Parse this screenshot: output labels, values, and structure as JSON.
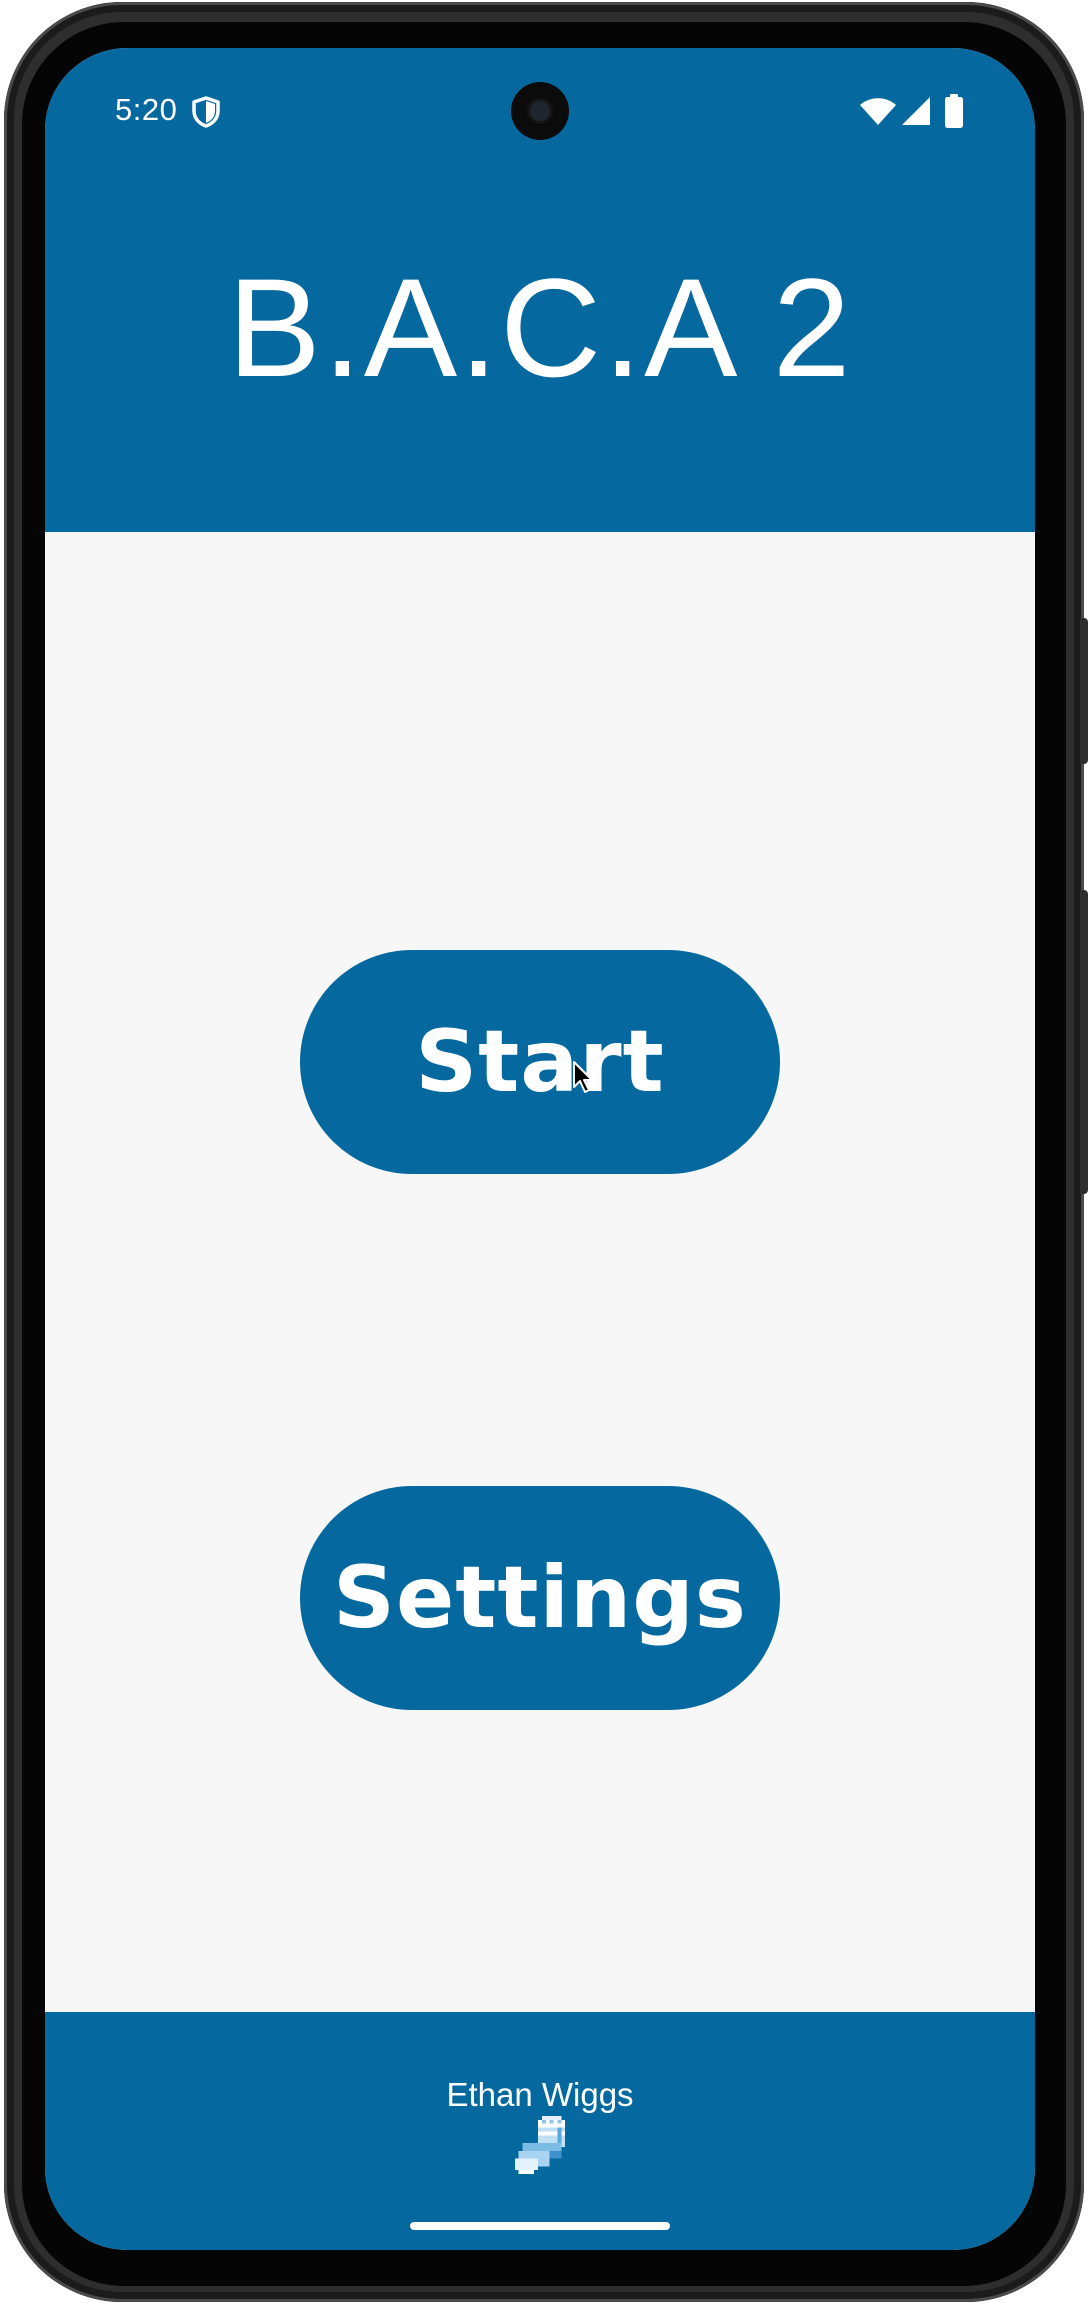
{
  "status_bar": {
    "time": "5:20",
    "icons": [
      "shield-icon",
      "wifi-icon",
      "signal-icon",
      "battery-icon"
    ]
  },
  "app": {
    "title": "B.A.C.A 2"
  },
  "buttons": {
    "start_label": "Start",
    "settings_label": "Settings"
  },
  "footer": {
    "author": "Ethan Wiggs",
    "icon": "sock-icon"
  },
  "colors": {
    "primary": "#05689f",
    "background": "#f7f7f7",
    "on_primary": "#ffffff"
  }
}
